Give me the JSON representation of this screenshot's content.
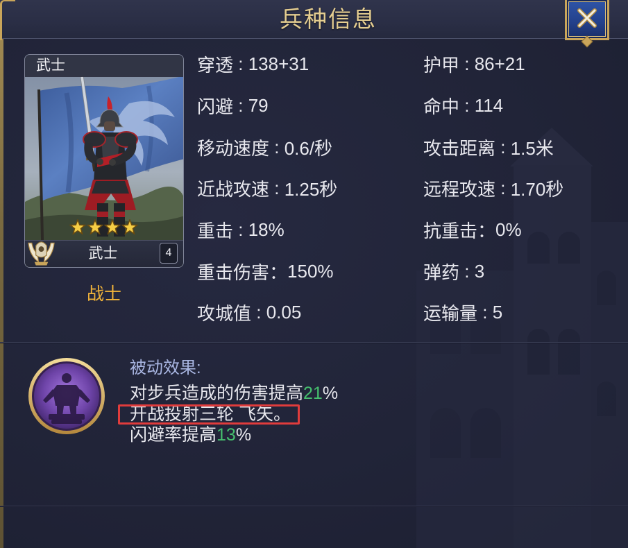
{
  "window": {
    "title": "兵种信息",
    "close_icon": "close-icon"
  },
  "unit_card": {
    "header_name": "武士",
    "stars": 4,
    "star_icon": "star-icon",
    "footer_name": "武士",
    "level": "4",
    "emblem_icon": "unit-class-emblem-icon"
  },
  "unit_role": "战士",
  "stats": {
    "left": [
      {
        "label": "穿透",
        "sep": " : ",
        "value": "138+31"
      },
      {
        "label": "闪避",
        "sep": " : ",
        "value": "79"
      },
      {
        "label": "移动速度",
        "sep": " : ",
        "value": "0.6/秒"
      },
      {
        "label": "近战攻速",
        "sep": " : ",
        "value": "1.25秒"
      },
      {
        "label": "重击",
        "sep": " : ",
        "value": "18%"
      },
      {
        "label": "重击伤害",
        "sep": "：",
        "value": "150%"
      },
      {
        "label": "攻城值",
        "sep": " : ",
        "value": "0.05"
      }
    ],
    "right": [
      {
        "label": "护甲",
        "sep": " : ",
        "value": "86+21"
      },
      {
        "label": "命中",
        "sep": " : ",
        "value": "114"
      },
      {
        "label": "攻击距离",
        "sep": " : ",
        "value": "1.5米"
      },
      {
        "label": "远程攻速",
        "sep": " : ",
        "value": "1.70秒"
      },
      {
        "label": "抗重击",
        "sep": "：",
        "value": "0%"
      },
      {
        "label": "弹药",
        "sep": " : ",
        "value": "3"
      },
      {
        "label": "运输量",
        "sep": " : ",
        "value": "5"
      }
    ]
  },
  "passive": {
    "icon": "passive-skill-icon",
    "title": "被动效果:",
    "lines": [
      {
        "prefix": "对步兵造成的伤害提高",
        "number": "21",
        "suffix": "%"
      },
      {
        "text": "开战投射三轮 飞矢。",
        "highlighted": true
      },
      {
        "prefix": "闪避率提高",
        "number": "13",
        "suffix": "%"
      }
    ]
  },
  "colors": {
    "title": "#e4cd90",
    "text": "#e8e8ee",
    "role": "#f2b43a",
    "passive_title": "#a9b6e2",
    "number_highlight": "#46c06e",
    "annotation_box": "#e03c3c",
    "frame_gold": "#c9a55a",
    "close_button": "#23408a"
  }
}
